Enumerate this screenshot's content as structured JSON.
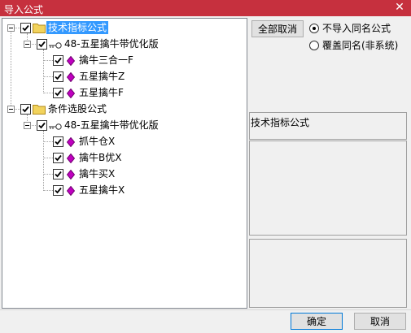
{
  "window": {
    "title": "导入公式",
    "close_symbol": "✕"
  },
  "tree": {
    "groups": [
      {
        "label": "技术指标公式",
        "selected": true,
        "checked": true,
        "icon": "folder-icon",
        "child": {
          "label": "48-五星擒牛带优化版",
          "checked": true,
          "icon": "key-icon",
          "items": [
            {
              "label": "擒牛三合一F",
              "checked": true,
              "icon": "gem-icon"
            },
            {
              "label": "五星擒牛Z",
              "checked": true,
              "icon": "gem-icon"
            },
            {
              "label": "五星擒牛F",
              "checked": true,
              "icon": "gem-icon"
            }
          ]
        }
      },
      {
        "label": "条件选股公式",
        "selected": false,
        "checked": true,
        "icon": "folder-icon",
        "child": {
          "label": "48-五星擒牛带优化版",
          "checked": true,
          "icon": "key-icon",
          "items": [
            {
              "label": "抓牛仓X",
              "checked": true,
              "icon": "gem-icon"
            },
            {
              "label": "擒牛B优X",
              "checked": true,
              "icon": "gem-icon"
            },
            {
              "label": "擒牛买X",
              "checked": true,
              "icon": "gem-icon"
            },
            {
              "label": "五星擒牛X",
              "checked": true,
              "icon": "gem-icon"
            }
          ]
        }
      }
    ]
  },
  "right": {
    "deselect_all_label": "全部取消",
    "options": [
      {
        "label": "不导入同名公式",
        "checked": true
      },
      {
        "label": "覆盖同名(非系统)",
        "checked": false
      }
    ],
    "info_title": "技术指标公式"
  },
  "footer": {
    "ok_label": "确定",
    "cancel_label": "取消"
  },
  "colors": {
    "titlebar": "#c6303e",
    "selection": "#3399ff",
    "gem": "#c000c0",
    "folder": "#f2d35c"
  }
}
